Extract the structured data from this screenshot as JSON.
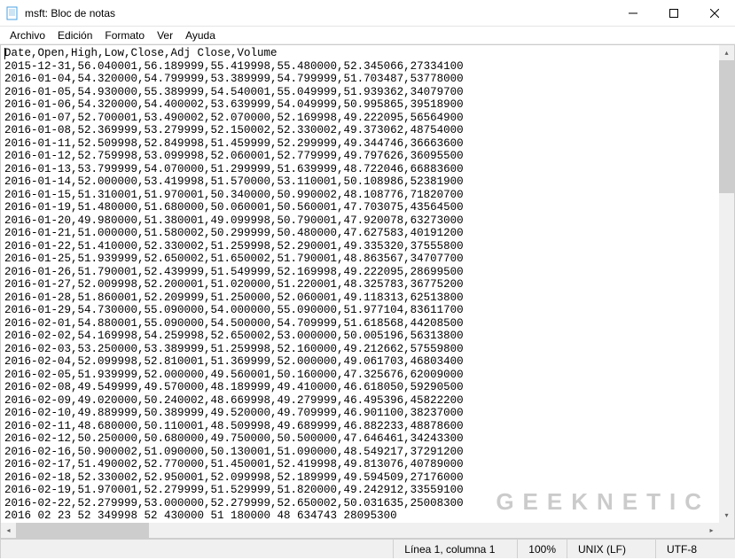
{
  "window": {
    "title": "msft: Bloc de notas"
  },
  "menu": {
    "file": "Archivo",
    "edit": "Edición",
    "format": "Formato",
    "view": "Ver",
    "help": "Ayuda"
  },
  "content": {
    "header": "Date,Open,High,Low,Close,Adj Close,Volume",
    "rows": [
      "2015-12-31,56.040001,56.189999,55.419998,55.480000,52.345066,27334100",
      "2016-01-04,54.320000,54.799999,53.389999,54.799999,51.703487,53778000",
      "2016-01-05,54.930000,55.389999,54.540001,55.049999,51.939362,34079700",
      "2016-01-06,54.320000,54.400002,53.639999,54.049999,50.995865,39518900",
      "2016-01-07,52.700001,53.490002,52.070000,52.169998,49.222095,56564900",
      "2016-01-08,52.369999,53.279999,52.150002,52.330002,49.373062,48754000",
      "2016-01-11,52.509998,52.849998,51.459999,52.299999,49.344746,36663600",
      "2016-01-12,52.759998,53.099998,52.060001,52.779999,49.797626,36095500",
      "2016-01-13,53.799999,54.070000,51.299999,51.639999,48.722046,66883600",
      "2016-01-14,52.000000,53.419998,51.570000,53.110001,50.108986,52381900",
      "2016-01-15,51.310001,51.970001,50.340000,50.990002,48.108776,71820700",
      "2016-01-19,51.480000,51.680000,50.060001,50.560001,47.703075,43564500",
      "2016-01-20,49.980000,51.380001,49.099998,50.790001,47.920078,63273000",
      "2016-01-21,51.000000,51.580002,50.299999,50.480000,47.627583,40191200",
      "2016-01-22,51.410000,52.330002,51.259998,52.290001,49.335320,37555800",
      "2016-01-25,51.939999,52.650002,51.650002,51.790001,48.863567,34707700",
      "2016-01-26,51.790001,52.439999,51.549999,52.169998,49.222095,28699500",
      "2016-01-27,52.009998,52.200001,51.020000,51.220001,48.325783,36775200",
      "2016-01-28,51.860001,52.209999,51.250000,52.060001,49.118313,62513800",
      "2016-01-29,54.730000,55.090000,54.000000,55.090000,51.977104,83611700",
      "2016-02-01,54.880001,55.090000,54.500000,54.709999,51.618568,44208500",
      "2016-02-02,54.169998,54.259998,52.650002,53.000000,50.005196,56313800",
      "2016-02-03,53.250000,53.389999,51.259998,52.160000,49.212662,57559800",
      "2016-02-04,52.099998,52.810001,51.369999,52.000000,49.061703,46803400",
      "2016-02-05,51.939999,52.000000,49.560001,50.160000,47.325676,62009000",
      "2016-02-08,49.549999,49.570000,48.189999,49.410000,46.618050,59290500",
      "2016-02-09,49.020000,50.240002,48.669998,49.279999,46.495396,45822200",
      "2016-02-10,49.889999,50.389999,49.520000,49.709999,46.901100,38237000",
      "2016-02-11,48.680000,50.110001,48.509998,49.689999,46.882233,48878600",
      "2016-02-12,50.250000,50.680000,49.750000,50.500000,47.646461,34243300",
      "2016-02-16,50.900002,51.090000,50.130001,51.090000,48.549217,37291200",
      "2016-02-17,51.490002,52.770000,51.450001,52.419998,49.813076,40789000",
      "2016-02-18,52.330002,52.950001,52.099998,52.189999,49.594509,27176000",
      "2016-02-19,51.970001,52.279999,51.529999,51.820000,49.242912,33559100",
      "2016-02-22,52.279999,53.000000,52.279999,52.650002,50.031635,25008300",
      "2016 02 23 52 349998 52 430000 51 180000 48 634743 28095300"
    ]
  },
  "status": {
    "position": "Línea 1, columna 1",
    "zoom": "100%",
    "line_ending": "UNIX (LF)",
    "encoding": "UTF-8"
  },
  "watermark": "GEEKNETIC",
  "chart_data": {
    "type": "table",
    "title": "msft",
    "columns": [
      "Date",
      "Open",
      "High",
      "Low",
      "Close",
      "Adj Close",
      "Volume"
    ],
    "rows": [
      [
        "2015-12-31",
        56.040001,
        56.189999,
        55.419998,
        55.48,
        52.345066,
        27334100
      ],
      [
        "2016-01-04",
        54.32,
        54.799999,
        53.389999,
        54.799999,
        51.703487,
        53778000
      ],
      [
        "2016-01-05",
        54.93,
        55.389999,
        54.540001,
        55.049999,
        51.939362,
        34079700
      ],
      [
        "2016-01-06",
        54.32,
        54.400002,
        53.639999,
        54.049999,
        50.995865,
        39518900
      ],
      [
        "2016-01-07",
        52.700001,
        53.490002,
        52.07,
        52.169998,
        49.222095,
        56564900
      ],
      [
        "2016-01-08",
        52.369999,
        53.279999,
        52.150002,
        52.330002,
        49.373062,
        48754000
      ],
      [
        "2016-01-11",
        52.509998,
        52.849998,
        51.459999,
        52.299999,
        49.344746,
        36663600
      ],
      [
        "2016-01-12",
        52.759998,
        53.099998,
        52.060001,
        52.779999,
        49.797626,
        36095500
      ],
      [
        "2016-01-13",
        53.799999,
        54.07,
        51.299999,
        51.639999,
        48.722046,
        66883600
      ],
      [
        "2016-01-14",
        52.0,
        53.419998,
        51.57,
        53.110001,
        50.108986,
        52381900
      ],
      [
        "2016-01-15",
        51.310001,
        51.970001,
        50.34,
        50.990002,
        48.108776,
        71820700
      ],
      [
        "2016-01-19",
        51.48,
        51.68,
        50.060001,
        50.560001,
        47.703075,
        43564500
      ],
      [
        "2016-01-20",
        49.98,
        51.380001,
        49.099998,
        50.790001,
        47.920078,
        63273000
      ],
      [
        "2016-01-21",
        51.0,
        51.580002,
        50.299999,
        50.48,
        47.627583,
        40191200
      ],
      [
        "2016-01-22",
        51.41,
        52.330002,
        51.259998,
        52.290001,
        49.33532,
        37555800
      ],
      [
        "2016-01-25",
        51.939999,
        52.650002,
        51.650002,
        51.790001,
        48.863567,
        34707700
      ],
      [
        "2016-01-26",
        51.790001,
        52.439999,
        51.549999,
        52.169998,
        49.222095,
        28699500
      ],
      [
        "2016-01-27",
        52.009998,
        52.200001,
        51.02,
        51.220001,
        48.325783,
        36775200
      ],
      [
        "2016-01-28",
        51.860001,
        52.209999,
        51.25,
        52.060001,
        49.118313,
        62513800
      ],
      [
        "2016-01-29",
        54.73,
        55.09,
        54.0,
        55.09,
        51.977104,
        83611700
      ],
      [
        "2016-02-01",
        54.880001,
        55.09,
        54.5,
        54.709999,
        51.618568,
        44208500
      ],
      [
        "2016-02-02",
        54.169998,
        54.259998,
        52.650002,
        53.0,
        50.005196,
        56313800
      ],
      [
        "2016-02-03",
        53.25,
        53.389999,
        51.259998,
        52.16,
        49.212662,
        57559800
      ],
      [
        "2016-02-04",
        52.099998,
        52.810001,
        51.369999,
        52.0,
        49.061703,
        46803400
      ],
      [
        "2016-02-05",
        51.939999,
        52.0,
        49.560001,
        50.16,
        47.325676,
        62009000
      ],
      [
        "2016-02-08",
        49.549999,
        49.57,
        48.189999,
        49.41,
        46.61805,
        59290500
      ],
      [
        "2016-02-09",
        49.02,
        50.240002,
        48.669998,
        49.279999,
        46.495396,
        45822200
      ],
      [
        "2016-02-10",
        49.889999,
        50.389999,
        49.52,
        49.709999,
        46.9011,
        38237000
      ],
      [
        "2016-02-11",
        48.68,
        50.110001,
        48.509998,
        49.689999,
        46.882233,
        48878600
      ],
      [
        "2016-02-12",
        50.25,
        50.68,
        49.75,
        50.5,
        47.646461,
        34243300
      ],
      [
        "2016-02-16",
        50.900002,
        51.09,
        50.130001,
        51.09,
        48.549217,
        37291200
      ],
      [
        "2016-02-17",
        51.490002,
        52.77,
        51.450001,
        52.419998,
        49.813076,
        40789000
      ],
      [
        "2016-02-18",
        52.330002,
        52.950001,
        52.099998,
        52.189999,
        49.594509,
        27176000
      ],
      [
        "2016-02-19",
        51.970001,
        52.279999,
        51.529999,
        51.82,
        49.242912,
        33559100
      ],
      [
        "2016-02-22",
        52.279999,
        53.0,
        52.279999,
        52.650002,
        50.031635,
        25008300
      ]
    ]
  }
}
